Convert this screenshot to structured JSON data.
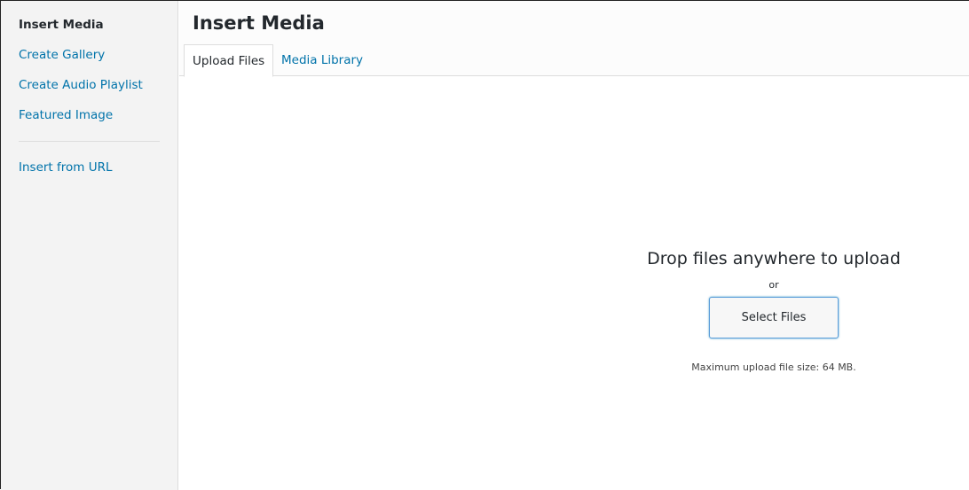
{
  "sidebar": {
    "items": [
      {
        "label": "Insert Media"
      },
      {
        "label": "Create Gallery"
      },
      {
        "label": "Create Audio Playlist"
      },
      {
        "label": "Featured Image"
      },
      {
        "label": "Insert from URL"
      }
    ]
  },
  "header": {
    "title": "Insert Media",
    "tabs": [
      {
        "label": "Upload Files"
      },
      {
        "label": "Media Library"
      }
    ]
  },
  "upload": {
    "drop_text": "Drop files anywhere to upload",
    "or": "or",
    "select_button": "Select Files",
    "max_size": "Maximum upload file size: 64 MB."
  }
}
